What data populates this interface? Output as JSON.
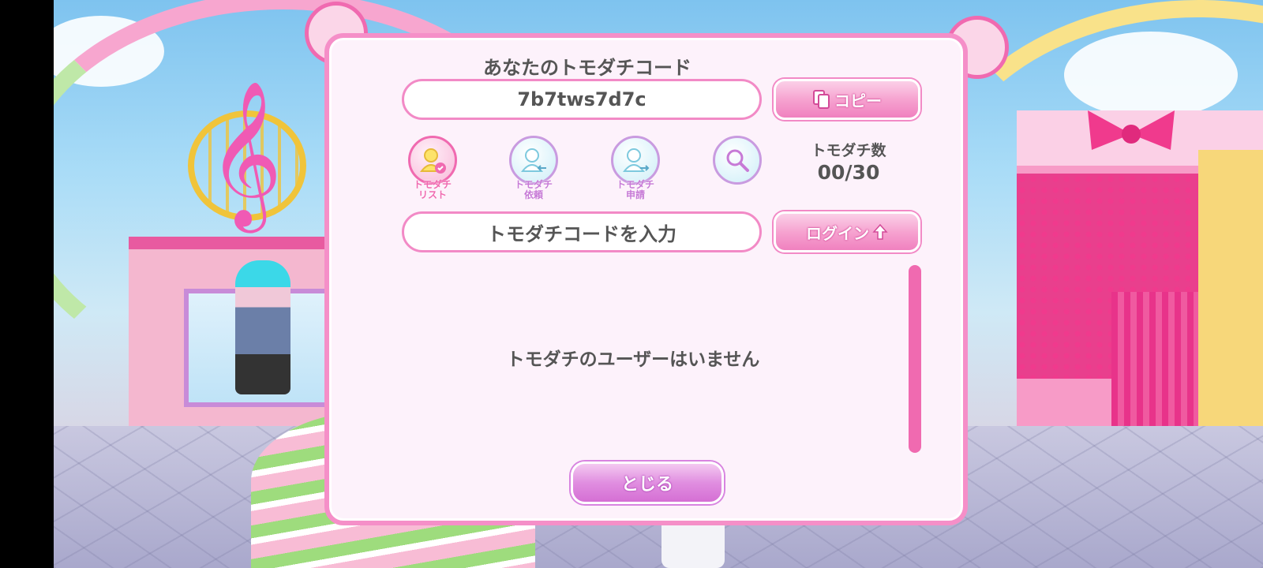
{
  "dialog": {
    "title": "あなたのトモダチコード",
    "code": "7b7tws7d7c",
    "copy_label": "コピー",
    "code_input_placeholder": "トモダチコードを入力",
    "login_label": "ログイン",
    "count_label": "トモダチ数",
    "count_value": "00/30",
    "empty_message": "トモダチのユーザーはいません",
    "close_label": "とじる",
    "icons": [
      {
        "name": "friend-list",
        "label_line1": "トモダチ",
        "label_line2": "リスト",
        "active": true
      },
      {
        "name": "friend-requests",
        "label_line1": "トモダチ",
        "label_line2": "依頼",
        "active": false
      },
      {
        "name": "friend-applications",
        "label_line1": "トモダチ",
        "label_line2": "申請",
        "active": false
      },
      {
        "name": "search",
        "label_line1": "",
        "label_line2": "",
        "active": false
      }
    ]
  },
  "colors": {
    "dialog_border": "#f58fc8",
    "accent_pink": "#f06ab0",
    "close_purple": "#d56fd4"
  }
}
